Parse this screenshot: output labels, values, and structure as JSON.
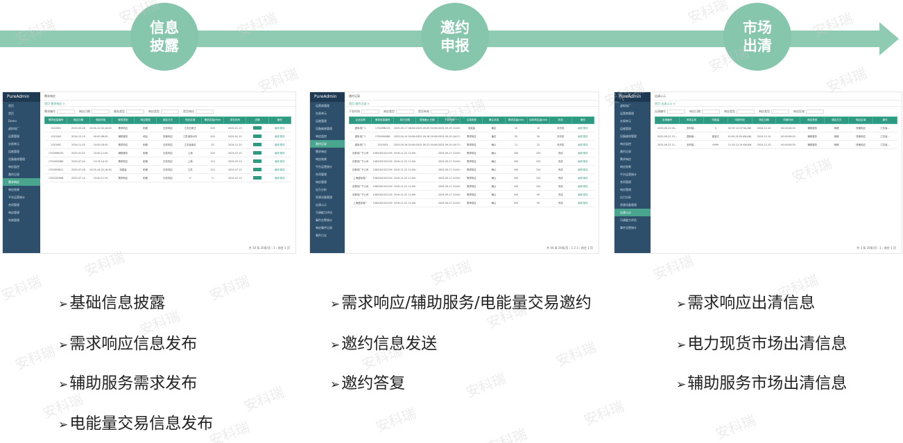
{
  "flow": {
    "stages": [
      {
        "label": "信息\n披露",
        "l1": "信息",
        "l2": "披露"
      },
      {
        "label": "邀约\n申报",
        "l1": "邀约",
        "l2": "申报"
      },
      {
        "label": "市场\n出清",
        "l1": "市场",
        "l2": "出清"
      }
    ]
  },
  "watermark": "安科瑞",
  "mini1": {
    "logo": "PureAdmin",
    "title": "需求响应",
    "tab": "首页  需求响应 ×",
    "sidebar": [
      "首页",
      "首页",
      "Demo",
      "虚拟电厂",
      "运营管理",
      "交易单元",
      "运维管理",
      "设备维修管理",
      "响应监控",
      "邀约记录",
      "需求响应",
      "响应效果",
      "平台运营统计",
      "合同管理",
      "响应管理",
      "系统管理"
    ],
    "active_index": 10,
    "filter_labels": [
      "需求编号",
      "响应日期",
      "服务类型",
      "响应类型",
      "是否响应"
    ],
    "headers": [
      "需求信息编号",
      "响应日期",
      "响应时段",
      "服务类型",
      "响应类型",
      "调控方式",
      "响应区域",
      "需求容量(MW)",
      "发布时间",
      "详情",
      "操作"
    ],
    "rows": [
      [
        "1310001",
        "2025-03-28",
        "10:00-12:00,16:00-18:00",
        "需求响应",
        "削峰",
        "日前响应",
        "江苏石家庄",
        "200",
        "2025-01-15"
      ],
      [
        "1310003",
        "2024-12-19",
        "00:00-08:00",
        "辅助服务",
        "填谷",
        "快速响应",
        "江苏省徐州市",
        "200",
        "2025-01-15"
      ],
      [
        "1310002",
        "2024-11-05",
        "10:00-18:00",
        "需求响应",
        "削峰",
        "日前响应",
        "江苏省南京",
        "20",
        "2024-11-25"
      ],
      [
        "1752698133",
        "2025-07-01",
        "10:00-11:00",
        "辅助服务",
        "削峰",
        "日前响应",
        "上海",
        "100",
        "2025-07-15"
      ],
      [
        "1752694386",
        "2025-07-04",
        "13:15-14:15",
        "需求响应",
        "削峰",
        "日前响应",
        "上海",
        "174",
        "2025-07-15"
      ],
      [
        "1752693611",
        "2025-07-08",
        "13:25-14:25,16:30-20:30",
        "电能量",
        "削峰",
        "日前响应",
        "江苏",
        "125",
        "2025-07-15"
      ],
      [
        "1753267668",
        "2025-07-14",
        "10:00-11:30",
        "需求响应",
        "削峰",
        "日前响应",
        "H",
        "H",
        "2025-07-15"
      ]
    ],
    "detail_label": "详情",
    "op_label": "编辑 删除",
    "pager": "共 10 条   20条/页   ‹  1  ›   前往  1  页"
  },
  "mini2": {
    "logo": "PureAdmin",
    "title": "邀约记录",
    "tab": "首页  邀约记录 ×",
    "sidebar": [
      "运营商管理",
      "交易单元",
      "运维管理",
      "设备维修管理",
      "响应监控",
      "邀约记录",
      "需求响应",
      "响应效果",
      "平台运营统计",
      "合同管理",
      "响应管理",
      "出力分析",
      "资源设备管理",
      "出清公示",
      "可调能力评估",
      "事件告警统计",
      "响应事件记录",
      "事件日志"
    ],
    "active_index": 5,
    "filter_labels": [
      "下发时间",
      "响应类型",
      "是否有效"
    ],
    "headers": [
      "企业名称",
      "需求信息编号",
      "执行日期",
      "提报截止日期",
      "下发时间",
      "交易类型",
      "确认状态",
      "需求容量(kW)",
      "实际响应量(kW)",
      "状态",
      "操作"
    ],
    "rows": [
      [
        "虚拟电厂1",
        "1752698133",
        "2025-09-17 08:00:00-2025-09-18 00:00:00",
        "2025-09-09 00:00:00",
        "2025-09-19 10:00:00",
        "电能量",
        "确定",
        "10",
        "15",
        "未完成"
      ],
      [
        "虚拟电厂2",
        "1752694386",
        "2025-09-19 00:00:00-2025-09-20 00:00:00",
        "2025-09-18 00:00:00",
        "2025-09-19 16:57:45",
        "需求响应",
        "确定",
        "50",
        "50",
        "未完成"
      ],
      [
        "虚拟电厂3",
        "1310003",
        "2025-09-18 00:00:00-2025-09-20 00:00:00",
        "2025-09-23 00:00:00",
        "2025-09-19 16:17:05",
        "需求响应",
        "确认",
        "11",
        "22",
        "未完成"
      ],
      [
        "无锡电厂子公司",
        "1583181522139",
        "2019-11-22 11:00:00-2019-11-22 13:00:00",
        "",
        "2025-09-17 15:00:00",
        "需求响应",
        "确认",
        "200",
        "150",
        "完成"
      ],
      [
        "无锡电厂子公司",
        "1583181522139",
        "2019-11-22 11:00:00-2019-11-22 13:00:00",
        "",
        "2025-09-17 15:00:00",
        "需求响应",
        "确认",
        "200",
        "150",
        "完成"
      ],
      [
        "无锡电厂子公司",
        "1583181522139",
        "2019-11-22 11:00:00-2019-11-22 13:00:00",
        "",
        "2025-09-17 15:00:00",
        "需求响应",
        "确认",
        "200",
        "150",
        "完成"
      ],
      [
        "上海虚拟电厂",
        "1583181522139",
        "2019-11-22 11:00:00-2019-11-22 13:00:00",
        "",
        "2025-09-17 15:00:00",
        "需求响应",
        "确认",
        "200",
        "150",
        "完成"
      ],
      [
        "无锡电厂子公司",
        "1583181522139",
        "2019-11-22 11:00:00-2019-11-22 13:00:00",
        "",
        "2025-09-17 15:00:00",
        "需求响应",
        "确认",
        "200",
        "150",
        "完成"
      ],
      [
        "无锡电厂子公司",
        "1583181522139",
        "2019-11-22 11:00:00-2019-11-22 13:00:00",
        "",
        "2025-09-17 15:00:00",
        "需求响应",
        "确认",
        "200",
        "90",
        "完成"
      ],
      [
        "上海虚拟电厂",
        "1583181522139",
        "2019-11-22 11:00:00-2019-11-22 13:00:00",
        "",
        "2025-09-17 15:00:00",
        "需求响应",
        "确认",
        "200",
        "90",
        "完成"
      ]
    ],
    "op_label": "编辑 删除",
    "pager": "共 44 条   20条/页   ‹  1  2  3  ›   前往  1  页"
  },
  "mini3": {
    "logo": "PureAdmin",
    "title": "出清公示",
    "tab": "首页  出清公示 ×",
    "sidebar": [
      "虚拟电厂",
      "运营商管理",
      "交易单元",
      "运维管理",
      "设备维修管理",
      "响应监控",
      "邀约记录",
      "需求响应",
      "响应效果",
      "平台运营统计",
      "合同管理",
      "响应管理",
      "出力分析",
      "资源设备管理",
      "出清公示",
      "可调能力评估",
      "事件告警统计"
    ],
    "active_index": 14,
    "filter_labels": [
      "出清编号",
      "响应日期",
      "响应类型",
      "响应类型",
      "响应区域"
    ],
    "headers": [
      "出清编号",
      "市场主体",
      "申报量",
      "申报时段",
      "响应日期",
      "申报时间",
      "响应类型",
      "调控方式",
      "响应区域",
      "操作"
    ],
    "rows": [
      [
        "2025-09-22 00...",
        "安科瑞...",
        "4",
        "00:37-10:37 KA,KW",
        "2024-12-10",
        "00:00:00:00",
        "辅助服务",
        "削峰",
        "快速响应",
        "江苏省..."
      ],
      [
        "2025-09-22 15...",
        "国网南...",
        "爱迪达",
        "10:50-19:50 KW,KW,KW...",
        "2024-12-10",
        "00:00:00:00",
        "辅助服务",
        "削峰",
        "快速响应",
        "江苏省..."
      ],
      [
        "2025-09-22 11...",
        "安科瑞...",
        "6999",
        "11:14-12:14 KW,KW",
        "2024-12-10",
        "00:00:00:00",
        "辅助服务",
        "削峰",
        "快速响应",
        "江苏省..."
      ]
    ],
    "op_label": "编辑 ...",
    "pager": "共 3 条   20条/页   ‹  1  ›   前往  1  页"
  },
  "bullets": {
    "col1": [
      "基础信息披露",
      "需求响应信息发布",
      "辅助服务需求发布",
      "电能量交易信息发布"
    ],
    "col2": [
      "需求响应/辅助服务/电能量交易邀约",
      "邀约信息发送",
      "邀约答复"
    ],
    "col3": [
      "需求响应出清信息",
      "电力现货市场出清信息",
      "辅助服务市场出清信息"
    ]
  }
}
